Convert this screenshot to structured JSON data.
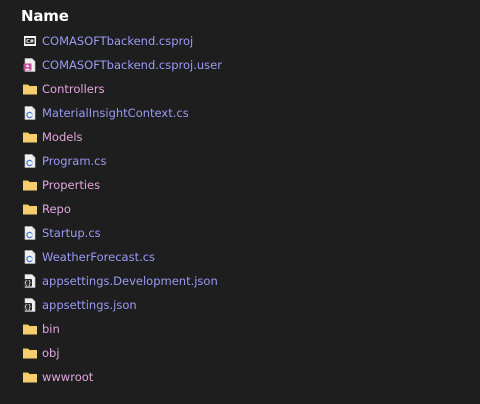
{
  "header": {
    "title": "Name"
  },
  "colors": {
    "background": "#1e1e1e",
    "file_text": "#9a9af6",
    "folder_text": "#e2a6e0",
    "folder_icon": "#f2c75c"
  },
  "items": [
    {
      "label": "COMASOFTbackend.csproj",
      "kind": "file",
      "icon": "csproj-icon"
    },
    {
      "label": "COMASOFTbackend.csproj.user",
      "kind": "file",
      "icon": "csproj-user-icon"
    },
    {
      "label": "Controllers",
      "kind": "folder",
      "icon": "folder-icon"
    },
    {
      "label": "MaterialInsightContext.cs",
      "kind": "file",
      "icon": "csharp-file-icon"
    },
    {
      "label": "Models",
      "kind": "folder",
      "icon": "folder-icon"
    },
    {
      "label": "Program.cs",
      "kind": "file",
      "icon": "csharp-file-icon"
    },
    {
      "label": "Properties",
      "kind": "folder",
      "icon": "folder-icon"
    },
    {
      "label": "Repo",
      "kind": "folder",
      "icon": "folder-icon"
    },
    {
      "label": "Startup.cs",
      "kind": "file",
      "icon": "csharp-file-icon"
    },
    {
      "label": "WeatherForecast.cs",
      "kind": "file",
      "icon": "csharp-file-icon"
    },
    {
      "label": "appsettings.Development.json",
      "kind": "file",
      "icon": "json-file-icon"
    },
    {
      "label": "appsettings.json",
      "kind": "file",
      "icon": "json-file-icon"
    },
    {
      "label": "bin",
      "kind": "folder",
      "icon": "folder-icon"
    },
    {
      "label": "obj",
      "kind": "folder",
      "icon": "folder-icon"
    },
    {
      "label": "wwwroot",
      "kind": "folder",
      "icon": "folder-icon"
    }
  ]
}
